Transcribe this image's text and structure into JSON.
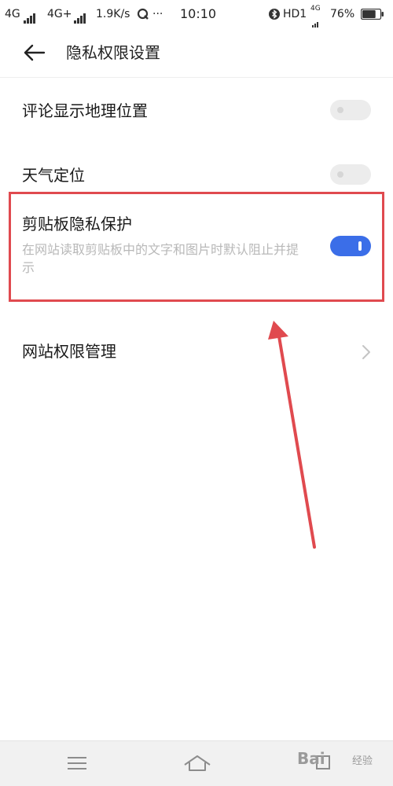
{
  "status_bar": {
    "net1": "4G",
    "net2": "4G+",
    "speed": "1.9K/s",
    "more": "···",
    "time": "10:10",
    "hd": "HD1",
    "lte": "4G",
    "battery_text": "76%",
    "battery_level": 0.76
  },
  "header": {
    "title": "隐私权限设置"
  },
  "settings": {
    "comment_location": {
      "label": "评论显示地理位置",
      "enabled": false
    },
    "weather_location": {
      "label": "天气定位",
      "enabled": false
    },
    "clipboard_protection": {
      "label": "剪贴板隐私保护",
      "description": "在网站读取剪贴板中的文字和图片时默认阻止并提示",
      "enabled": true
    },
    "site_permissions": {
      "label": "网站权限管理"
    }
  },
  "colors": {
    "accent": "#3b6ee8",
    "annotation": "#e04a4f"
  },
  "watermark": {
    "brand": "Bai",
    "sub": "经验"
  }
}
